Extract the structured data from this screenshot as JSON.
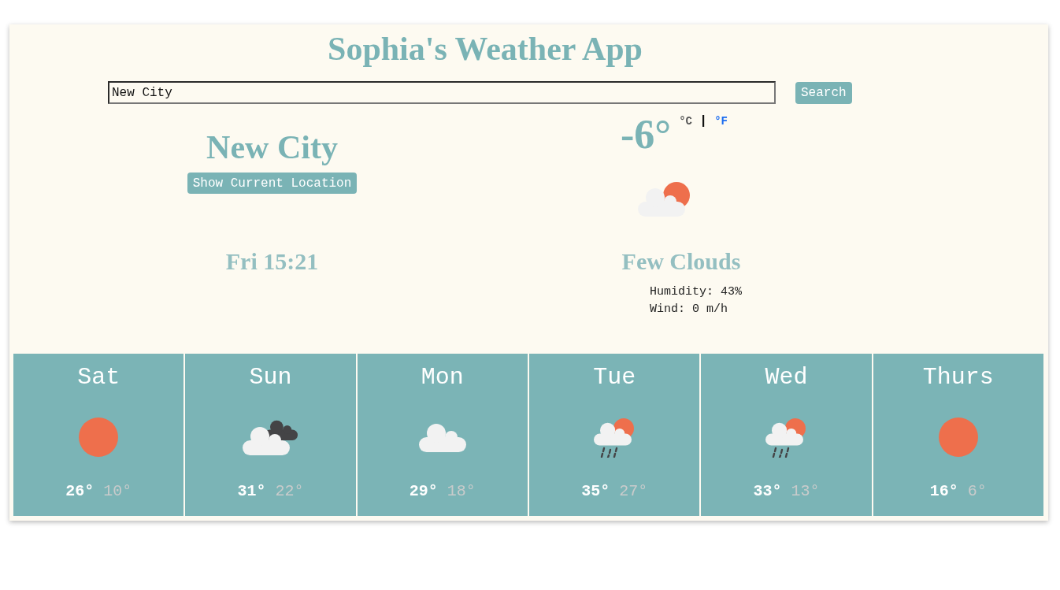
{
  "app": {
    "title": "Sophia's Weather App"
  },
  "search": {
    "value": "New City",
    "button": "Search"
  },
  "location": {
    "city": "New City",
    "button": "Show Current Location",
    "datetime": "Fri 15:21"
  },
  "current": {
    "temperature": "-6°",
    "units": [
      {
        "label": "°C",
        "selected": true
      },
      {
        "label": "°F",
        "selected": false
      }
    ],
    "unit_separator": "|",
    "kind": "cloud-sun",
    "description": "Few Clouds",
    "humidity": "Humidity: 43%",
    "wind": "Wind: 0 m/h"
  },
  "forecast": [
    {
      "day": "Sat",
      "kind": "sun",
      "high": "26°",
      "low": "10°"
    },
    {
      "day": "Sun",
      "kind": "clouds-dark",
      "high": "31°",
      "low": "22°"
    },
    {
      "day": "Mon",
      "kind": "cloud",
      "high": "29°",
      "low": "18°"
    },
    {
      "day": "Tue",
      "kind": "rain-sun",
      "high": "35°",
      "low": "27°"
    },
    {
      "day": "Wed",
      "kind": "rain-sun",
      "high": "33°",
      "low": "13°"
    },
    {
      "day": "Thurs",
      "kind": "sun",
      "high": "16°",
      "low": "6°"
    }
  ]
}
